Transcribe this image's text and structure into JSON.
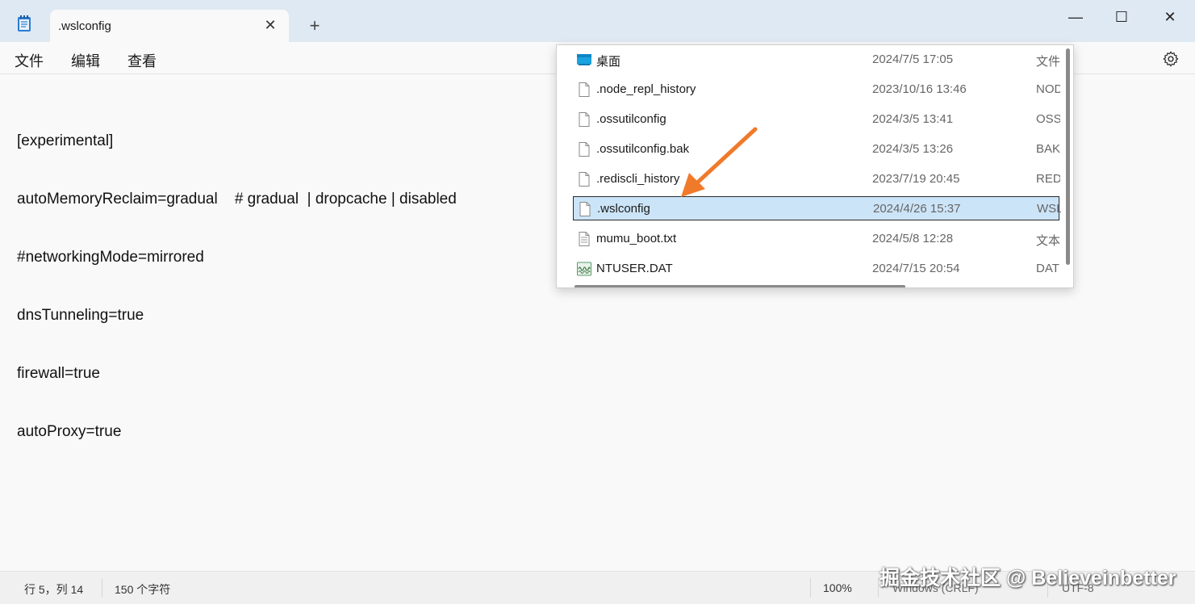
{
  "window": {
    "tab_title": ".wslconfig",
    "tab_close": "✕",
    "new_tab": "+",
    "minimize": "—",
    "maximize": "☐",
    "close": "✕"
  },
  "menu": {
    "file": "文件",
    "edit": "编辑",
    "view": "查看"
  },
  "editor": {
    "lines": [
      "[experimental]",
      "autoMemoryReclaim=gradual    # gradual  | dropcache | disabled",
      "#networkingMode=mirrored",
      "dnsTunneling=true",
      "firewall=true",
      "autoProxy=true"
    ]
  },
  "file_popup": {
    "files": [
      {
        "name": "桌面",
        "date": "2024/7/5 17:05",
        "type": "文件",
        "icon": "desktop-folder-icon",
        "selected": false
      },
      {
        "name": ".node_repl_history",
        "date": "2023/10/16 13:46",
        "type": "NOD",
        "icon": "file-icon",
        "selected": false
      },
      {
        "name": ".ossutilconfig",
        "date": "2024/3/5 13:41",
        "type": "OSS",
        "icon": "file-icon",
        "selected": false
      },
      {
        "name": ".ossutilconfig.bak",
        "date": "2024/3/5 13:26",
        "type": "BAK",
        "icon": "file-icon",
        "selected": false
      },
      {
        "name": ".rediscli_history",
        "date": "2023/7/19 20:45",
        "type": "RED",
        "icon": "file-icon",
        "selected": false
      },
      {
        "name": ".wslconfig",
        "date": "2024/4/26 15:37",
        "type": "WSL",
        "icon": "file-icon",
        "selected": true
      },
      {
        "name": "mumu_boot.txt",
        "date": "2024/5/8 12:28",
        "type": "文本",
        "icon": "text-file-icon",
        "selected": false
      },
      {
        "name": "NTUSER.DAT",
        "date": "2024/7/15 20:54",
        "type": "DAT",
        "icon": "dat-file-icon",
        "selected": false
      }
    ]
  },
  "status": {
    "position": "行 5，列 14",
    "chars": "150 个字符",
    "zoom": "100%",
    "eol": "Windows (CRLF)",
    "encoding": "UTF-8"
  },
  "watermark": "掘金技术社区 @ Believeinbetter",
  "colors": {
    "accent_arrow": "#f07a2a",
    "selection": "#cce4f7",
    "titlebar": "#dfe9f3"
  }
}
